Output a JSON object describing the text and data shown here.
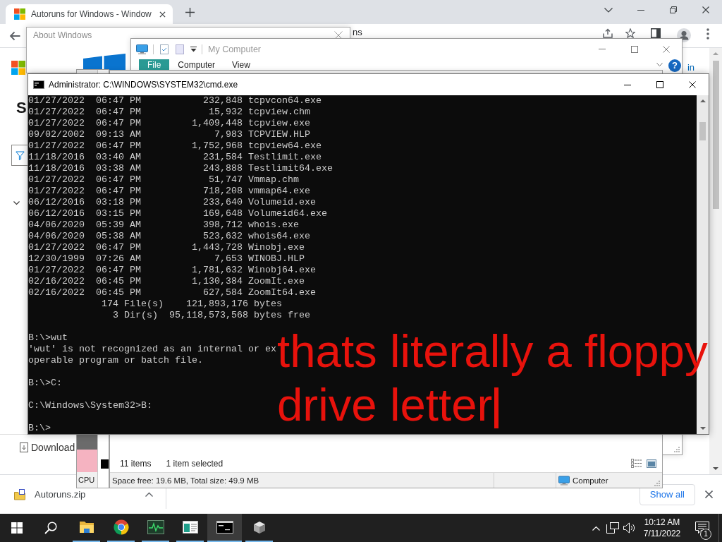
{
  "browser": {
    "tabs": [
      {
        "title": "Autoruns for Windows - Window",
        "selected": true
      }
    ],
    "address_fragment": "ns",
    "page": {
      "heading_fragment": "S",
      "header_link_fragment": "in",
      "nav_item": "Download"
    },
    "downloads_bar": {
      "file": "Autoruns.zip",
      "show_all": "Show all"
    }
  },
  "about_window": {
    "title": "About Windows"
  },
  "explorer_window": {
    "title": "My Computer",
    "ribbon_tabs": [
      {
        "label": "File",
        "selected": true
      },
      {
        "label": "Computer",
        "selected": false
      },
      {
        "label": "View",
        "selected": false
      }
    ],
    "help": "?"
  },
  "status_window": {
    "cpu_label": "CPU",
    "item_count": "11 items",
    "selection": "1 item selected",
    "space": "Space free: 19.6 MB, Total size: 49.9 MB",
    "location": "Computer"
  },
  "console": {
    "title": "Administrator: C:\\WINDOWS\\SYSTEM32\\cmd.exe",
    "blocks": [
      [
        "01/27/2022  06:47 PM           232,848 tcpvcon64.exe",
        "01/27/2022  06:47 PM            15,932 tcpview.chm",
        "01/27/2022  06:47 PM         1,409,448 tcpview.exe",
        "09/02/2002  09:13 AM             7,983 TCPVIEW.HLP",
        "01/27/2022  06:47 PM         1,752,968 tcpview64.exe",
        "11/18/2016  03:40 AM           231,584 Testlimit.exe",
        "11/18/2016  03:38 AM           243,888 Testlimit64.exe",
        "01/27/2022  06:47 PM            51,747 Vmmap.chm",
        "01/27/2022  06:47 PM           718,208 vmmap64.exe",
        "06/12/2016  03:18 PM           233,640 Volumeid.exe",
        "06/12/2016  03:15 PM           169,648 Volumeid64.exe",
        "04/06/2020  05:39 AM           398,712 whois.exe",
        "04/06/2020  05:38 AM           523,632 whois64.exe",
        "01/27/2022  06:47 PM         1,443,728 Winobj.exe",
        "12/30/1999  07:26 AM             7,653 WINOBJ.HLP",
        "01/27/2022  06:47 PM         1,781,632 Winobj64.exe",
        "02/16/2022  06:45 PM         1,130,384 ZoomIt.exe",
        "02/16/2022  06:45 PM           627,584 ZoomIt64.exe",
        "             174 File(s)    121,893,176 bytes",
        "               3 Dir(s)  95,118,573,568 bytes free"
      ],
      [
        "B:\\>wut",
        "'wut' is not recognized as an internal or ex",
        "operable program or batch file."
      ],
      [
        "B:\\>C:"
      ],
      [
        "C:\\Windows\\System32>B:"
      ],
      [
        "B:\\>"
      ]
    ]
  },
  "annotation": {
    "text": "thats literally a floppy drive letter",
    "caret": true
  },
  "taskbar": {
    "apps": [
      {
        "kind": "folder",
        "running": true,
        "selected": false
      },
      {
        "kind": "browser",
        "running": true,
        "selected": false
      },
      {
        "kind": "monitor",
        "running": true,
        "selected": false
      },
      {
        "kind": "window",
        "running": true,
        "selected": false
      },
      {
        "kind": "console",
        "running": true,
        "selected": true
      },
      {
        "kind": "box",
        "running": true,
        "selected": false
      }
    ],
    "clock": {
      "time": "10:12 AM",
      "date": "7/11/2022"
    },
    "notification_count": "1"
  }
}
